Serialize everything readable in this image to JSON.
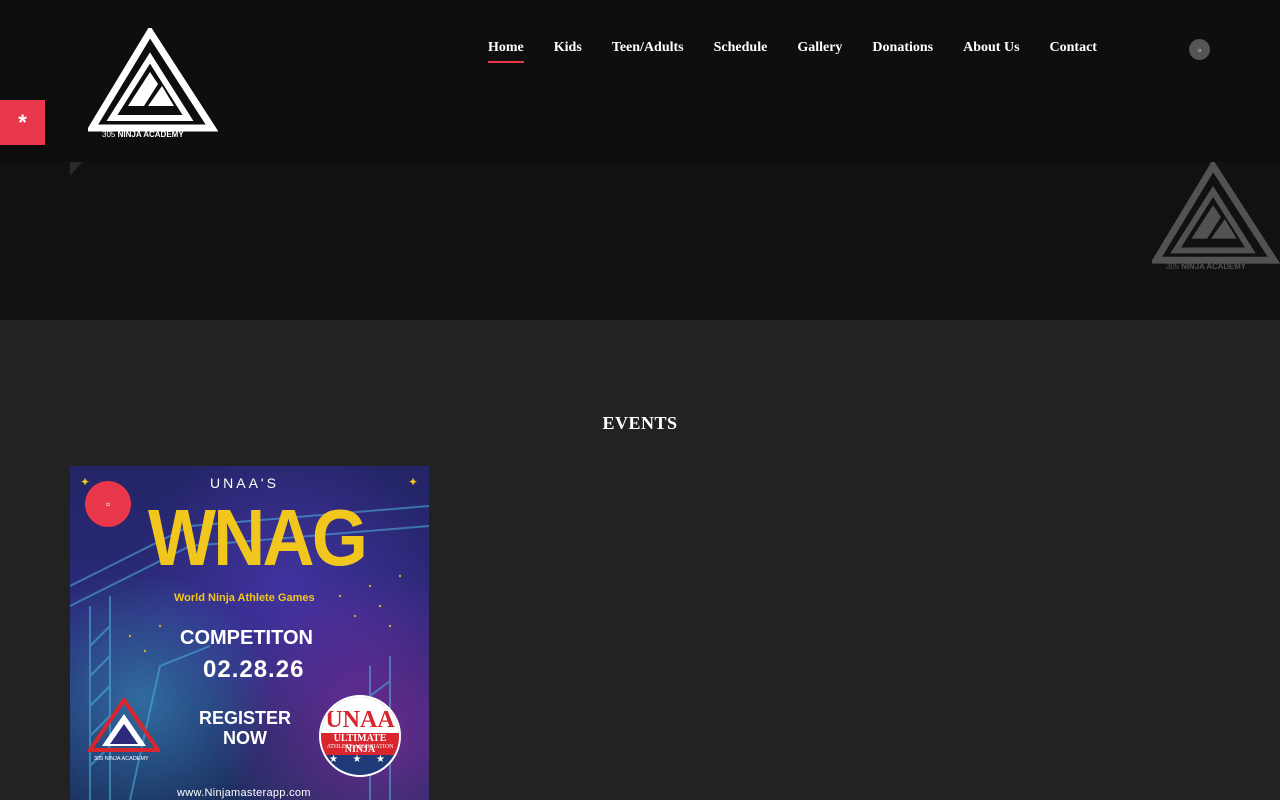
{
  "brand": {
    "name": "305 NINJA ACADEMY",
    "prefix": "305",
    "suffix": "NINJA ACADEMY"
  },
  "nav": {
    "items": [
      {
        "label": "Home",
        "active": true
      },
      {
        "label": "Kids",
        "active": false
      },
      {
        "label": "Teen/Adults",
        "active": false
      },
      {
        "label": "Schedule",
        "active": false
      },
      {
        "label": "Gallery",
        "active": false
      },
      {
        "label": "Donations",
        "active": false
      },
      {
        "label": "About Us",
        "active": false
      },
      {
        "label": "Contact",
        "active": false
      }
    ],
    "search_icon": "search-icon"
  },
  "accessibility": {
    "label": "*",
    "icon": "accessibility-icon"
  },
  "events": {
    "title": "EVENTS",
    "cards": [
      {
        "badge_icon": "calendar-icon",
        "poster": {
          "organizer": "UNAA'S",
          "headline": "WNAG",
          "subtitle": "World Ninja Athlete Games",
          "type": "COMPETITON",
          "date": "02.28.26",
          "cta_line1": "REGISTER",
          "cta_line2": "NOW",
          "website": "www.Ninjamasterapp.com",
          "seal_title": "UNAA",
          "seal_line1": "ULTIMATE NINJA",
          "seal_line2": "ATHLETE ASSOCIATION",
          "seal_stars": "★ ★ ★",
          "small_logo_text": "305 NINJA ACADEMY",
          "sparkle": "✦"
        }
      }
    ]
  },
  "colors": {
    "accent": "#e8374a",
    "header_bg": "#0e0e0e",
    "page_bg": "#222222",
    "poster_yellow": "#f2c71d"
  }
}
